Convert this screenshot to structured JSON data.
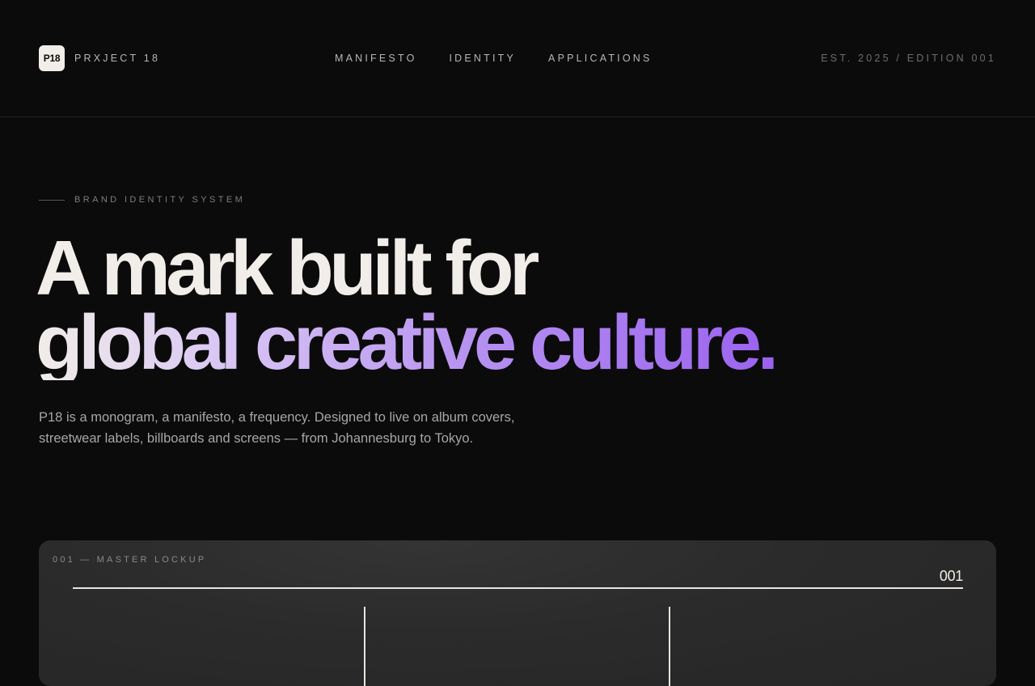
{
  "header": {
    "logo_text": "P18",
    "brand_name": "PRXJECT 18",
    "nav": [
      {
        "label": "MANIFESTO"
      },
      {
        "label": "IDENTITY"
      },
      {
        "label": "APPLICATIONS"
      }
    ],
    "edition": "EST. 2025 / EDITION 001"
  },
  "hero": {
    "eyebrow": "BRAND IDENTITY SYSTEM",
    "headline_line1": "A mark built for",
    "headline_line2": "global creative culture.",
    "lede": "P18 is a monogram, a manifesto, a frequency. Designed to live on album covers, streetwear labels, billboards and screens — from Johannesburg to Tokyo."
  },
  "card": {
    "label": "001 — MASTER LOCKUP",
    "number": "001"
  },
  "colors": {
    "background": "#0b0b0c",
    "text": "#f1ede8",
    "accent": "#9a62ef"
  }
}
